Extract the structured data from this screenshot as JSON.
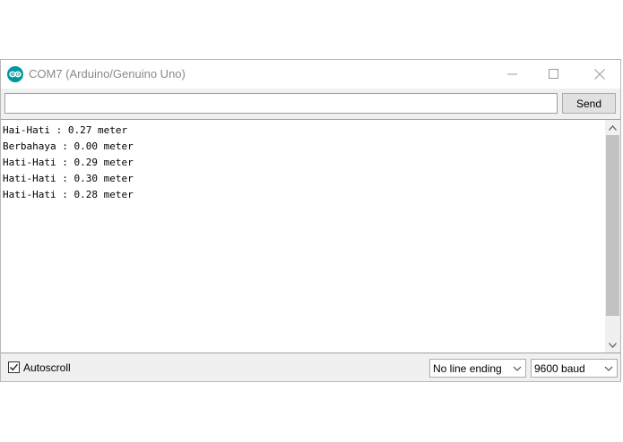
{
  "window": {
    "title": "COM7 (Arduino/Genuino Uno)",
    "icon": "arduino-logo-icon",
    "accent_color": "#00979d"
  },
  "input": {
    "value": "",
    "placeholder": "",
    "send_label": "Send"
  },
  "output": {
    "lines": [
      "Hai-Hati : 0.27 meter",
      "Berbahaya : 0.00 meter",
      "Hati-Hati : 0.29 meter",
      "Hati-Hati : 0.30 meter",
      "Hati-Hati : 0.28 meter"
    ]
  },
  "status_bar": {
    "autoscroll_label": "Autoscroll",
    "autoscroll_checked": true,
    "line_ending_selected": "No line ending",
    "baud_selected": "9600 baud"
  }
}
